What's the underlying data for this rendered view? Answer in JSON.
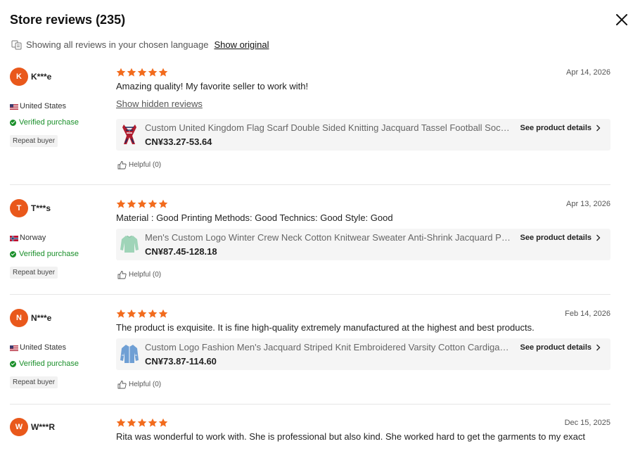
{
  "header": {
    "title": "Store reviews (235)"
  },
  "lang_bar": {
    "text": "Showing all reviews in your chosen language",
    "show_original": "Show original"
  },
  "colors": {
    "accent": "#e9581b",
    "star": "#f26b1d",
    "verified": "#1a8f2a"
  },
  "reviews": [
    {
      "initial": "K",
      "user": "K***e",
      "country": "United States",
      "flag": "us-flag-icon",
      "verified": "Verified purchase",
      "repeat": "Repeat buyer",
      "rating": 5,
      "date": "Apr 14, 2026",
      "text": "Amazing quality! My favorite seller to work with!",
      "hidden_link": "Show hidden reviews",
      "product": {
        "name": "Custom United Kingdom Flag Scarf Double Sided Knitting Jacquard Tassel Football Soccer Fan Scarf",
        "price": "CN¥33.27-53.64",
        "details": "See product details",
        "thumb": "scarf-thumbnail"
      },
      "helpful": "Helpful (0)"
    },
    {
      "initial": "T",
      "user": "T***s",
      "country": "Norway",
      "flag": "norway-flag-icon",
      "verified": "Verified purchase",
      "repeat": "Repeat buyer",
      "rating": 5,
      "date": "Apr 13, 2026",
      "text": "Material : Good Printing Methods: Good Technics: Good Style: Good",
      "product": {
        "name": "Men's Custom Logo Winter Crew Neck Cotton Knitwear Sweater Anti-Shrink Jacquard Pattern Pullover",
        "price": "CN¥87.45-128.18",
        "details": "See product details",
        "thumb": "sweater-thumbnail"
      },
      "helpful": "Helpful (0)"
    },
    {
      "initial": "N",
      "user": "N***e",
      "country": "United States",
      "flag": "us-flag-icon",
      "verified": "Verified purchase",
      "repeat": "Repeat buyer",
      "rating": 5,
      "date": "Feb 14, 2026",
      "text": "The product is exquisite. It is fine high-quality extremely manufactured at the highest and best products.",
      "product": {
        "name": "Custom Logo Fashion Men's Jacquard Striped Knit Embroidered Varsity Cotton Cardigan Sweater",
        "price": "CN¥73.87-114.60",
        "details": "See product details",
        "thumb": "cardigan-thumbnail"
      },
      "helpful": "Helpful (0)"
    },
    {
      "initial": "W",
      "user": "W***R",
      "rating": 5,
      "date": "Dec 15, 2025",
      "text": "Rita was wonderful to work with. She is professional but also kind. She worked hard to get the garments to my exact"
    }
  ]
}
